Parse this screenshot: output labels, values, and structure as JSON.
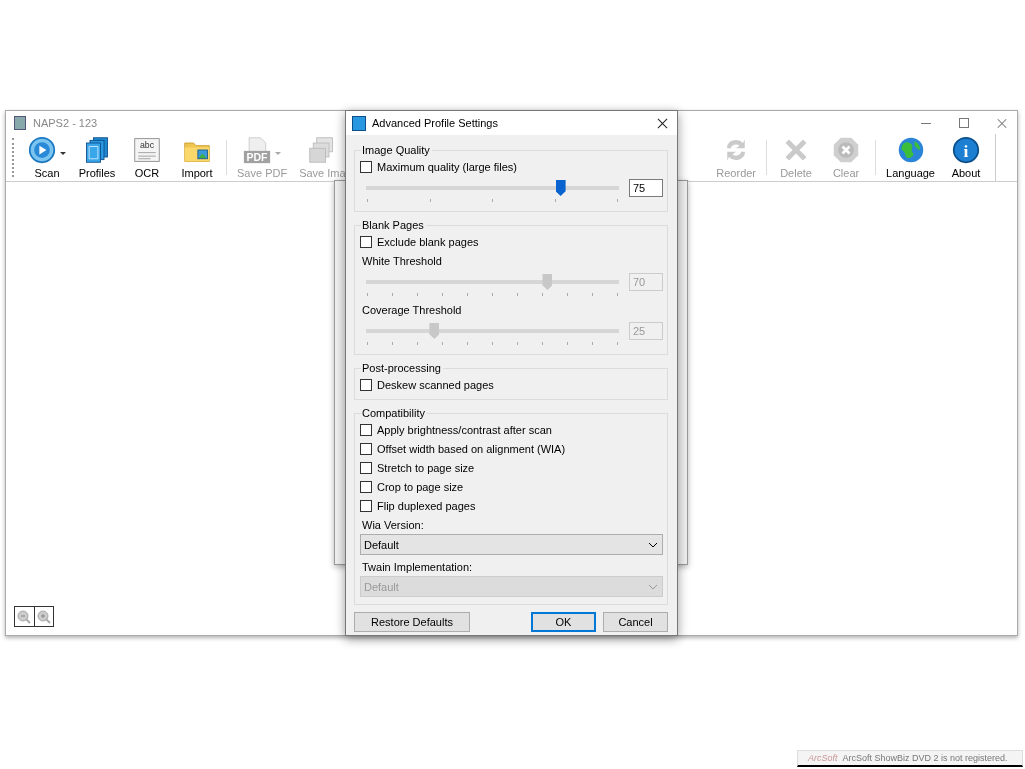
{
  "main_window": {
    "title": "NAPS2 - 123",
    "toolbar_left": [
      {
        "kind": "scan",
        "label": "Scan",
        "dropdown": true,
        "disabled": false
      },
      {
        "kind": "profiles",
        "label": "Profiles",
        "dropdown": false,
        "disabled": false
      },
      {
        "kind": "ocr",
        "label": "OCR",
        "icon_text": "abc",
        "dropdown": false,
        "disabled": false
      },
      {
        "kind": "import",
        "label": "Import",
        "dropdown": false,
        "disabled": false
      },
      {
        "kind": "separator"
      },
      {
        "kind": "pdf",
        "label": "Save PDF",
        "icon_text": "PDF",
        "dropdown": true,
        "disabled": true
      },
      {
        "kind": "images",
        "label": "Save Ima",
        "dropdown": false,
        "disabled": true
      }
    ],
    "toolbar_right": [
      {
        "kind": "reorder",
        "label": "Reorder",
        "dropdown": false,
        "disabled": true
      },
      {
        "kind": "separator"
      },
      {
        "kind": "delete",
        "label": "Delete",
        "dropdown": false,
        "disabled": true
      },
      {
        "kind": "clear",
        "label": "Clear",
        "dropdown": false,
        "disabled": true
      },
      {
        "kind": "separator"
      },
      {
        "kind": "language",
        "label": "Language",
        "dropdown": false,
        "disabled": false
      },
      {
        "kind": "about",
        "label": "About",
        "icon_text": "i",
        "dropdown": false,
        "disabled": false
      }
    ]
  },
  "dialog": {
    "title": "Advanced Profile Settings",
    "groups": [
      {
        "title": "Image Quality",
        "items": [
          {
            "kind": "checkbox",
            "label": "Maximum quality (large files)",
            "checked": false
          },
          {
            "kind": "slider",
            "level": 0.74,
            "value": "75",
            "disabled": false
          }
        ]
      },
      {
        "title": "Blank Pages",
        "items": [
          {
            "kind": "checkbox",
            "label": "Exclude blank pages",
            "checked": false
          },
          {
            "kind": "slider",
            "label": "White Threshold",
            "level": 0.69,
            "value": "70",
            "disabled": true
          },
          {
            "kind": "slider",
            "label": "Coverage Threshold",
            "level": 0.26,
            "value": "25",
            "disabled": true
          }
        ]
      },
      {
        "title": "Post-processing",
        "items": [
          {
            "kind": "checkbox",
            "label": "Deskew scanned pages",
            "checked": false
          }
        ]
      },
      {
        "title": "Compatibility",
        "items": [
          {
            "kind": "checkbox",
            "label": "Apply brightness/contrast after scan",
            "checked": false
          },
          {
            "kind": "checkbox",
            "label": "Offset width based on alignment (WIA)",
            "checked": false
          },
          {
            "kind": "checkbox",
            "label": "Stretch to page size",
            "checked": false
          },
          {
            "kind": "checkbox",
            "label": "Crop to page size",
            "checked": false
          },
          {
            "kind": "checkbox",
            "label": "Flip duplexed pages",
            "checked": false
          },
          {
            "kind": "dropdown",
            "label": "Wia Version:",
            "value": "Default",
            "disabled": false
          },
          {
            "kind": "dropdown",
            "label": "Twain Implementation:",
            "value": "Default",
            "disabled": true
          }
        ]
      }
    ],
    "buttons": [
      {
        "label": "Restore Defaults",
        "default": false
      },
      {
        "label": "OK",
        "default": true
      },
      {
        "label": "Cancel",
        "default": false
      }
    ]
  },
  "notification": {
    "logo": "ArcSoft",
    "text": "ArcSoft ShowBiz DVD 2 is not registered."
  }
}
